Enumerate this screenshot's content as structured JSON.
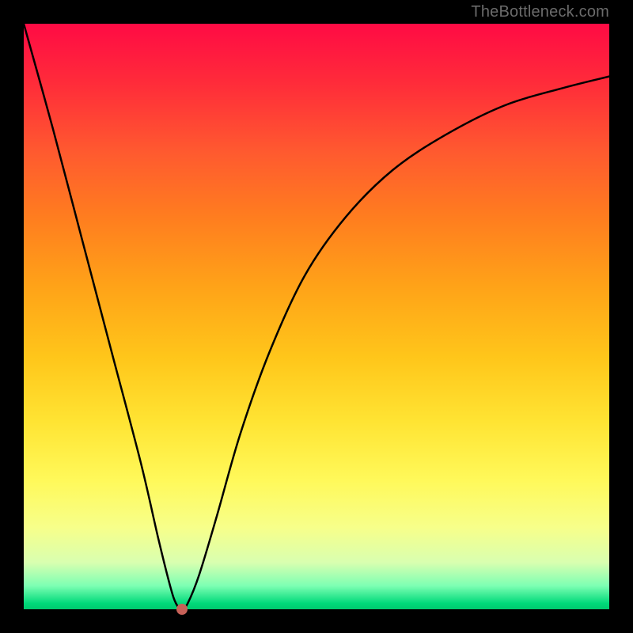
{
  "watermark": "TheBottleneck.com",
  "chart_data": {
    "type": "line",
    "title": "",
    "xlabel": "",
    "ylabel": "",
    "xlim": [
      0,
      100
    ],
    "ylim": [
      0,
      100
    ],
    "series": [
      {
        "name": "curve",
        "x": [
          0,
          5,
          10,
          15,
          20,
          23,
          25,
          26,
          27,
          28,
          30,
          33,
          37,
          42,
          48,
          55,
          63,
          72,
          82,
          92,
          100
        ],
        "values": [
          100,
          82,
          63,
          44,
          25,
          12,
          4,
          1,
          0,
          1,
          6,
          16,
          30,
          44,
          57,
          67,
          75,
          81,
          86,
          89,
          91
        ]
      }
    ],
    "marker": {
      "x": 27,
      "y": 0,
      "color": "#c76158"
    },
    "background_gradient": {
      "top": "#ff0b44",
      "mid1": "#ff7d1f",
      "mid2": "#ffe433",
      "bottom": "#00c96e"
    }
  }
}
